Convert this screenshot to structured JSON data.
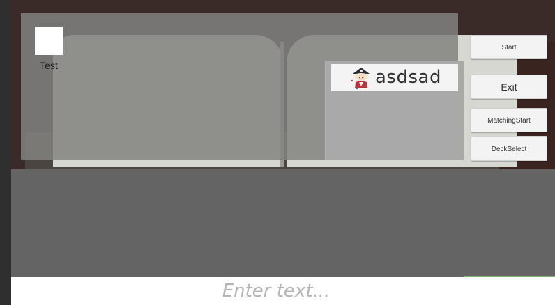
{
  "main_panel": {
    "item_label": "Test"
  },
  "card_panel": {
    "entry_name": "asdsad",
    "avatar_icon": "pirate-character-icon"
  },
  "buttons": {
    "start": "Start",
    "exit": "Exit",
    "matching_start": "MatchingStart",
    "deck_select": "DeckSelect"
  },
  "text_input": {
    "placeholder": "Enter text...",
    "value": ""
  },
  "colors": {
    "panel": "#828280",
    "lower_area": "#646464",
    "button_bg": "#f3f3f3",
    "accent_green": "#7bb070"
  }
}
